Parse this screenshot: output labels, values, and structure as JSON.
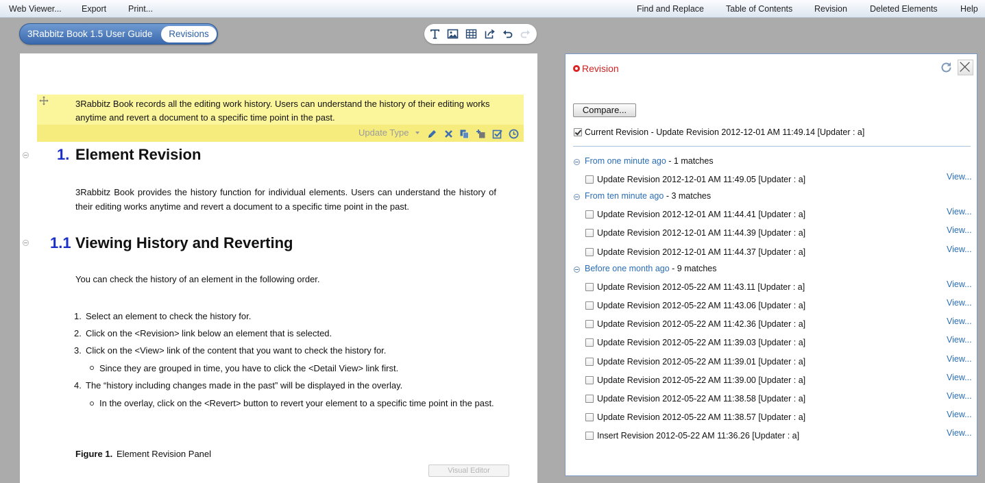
{
  "menu": {
    "left": [
      "Web Viewer...",
      "Export",
      "Print..."
    ],
    "right": [
      "Find and Replace",
      "Table of Contents",
      "Revision",
      "Deleted Elements",
      "Help"
    ]
  },
  "header": {
    "book_title": "3Rabbitz Book 1.5 User Guide",
    "revisions_button": "Revisions"
  },
  "toolbar": {
    "icons": [
      "text-icon",
      "image-icon",
      "table-icon",
      "export-icon",
      "undo-icon",
      "redo-icon"
    ]
  },
  "document": {
    "highlight_text": "3Rabbitz Book records all the editing work history. Users can understand the history of their editing works anytime and revert a document to a specific time point in the past.",
    "update_type_label": "Update Type",
    "element_icons": [
      "edit-icon",
      "delete-icon",
      "copy-icon",
      "insert-icon",
      "check-icon",
      "history-icon"
    ],
    "h1_number": "1.",
    "h1_title": "Element Revision",
    "para1": "3Rabbitz Book provides the history function for individual elements. Users can understand the history of their editing works anytime and revert a document to a specific time point in the past.",
    "h2_number": "1.1",
    "h2_title": "Viewing History and Reverting",
    "para2": "You can check the history of an element in the following order.",
    "steps": [
      {
        "num": "1.",
        "text": "Select an element to check the history for."
      },
      {
        "num": "2.",
        "text": "Click on the <Revision> link below an element that is selected."
      },
      {
        "num": "3.",
        "text": "Click on the <View> link of the content that you want to check the history for."
      },
      {
        "num": "4.",
        "text": "The “history including changes made in the past” will be displayed in the overlay."
      }
    ],
    "sub_steps": [
      "Since they are grouped in time, you have to click the <Detail View> link first.",
      "In the overlay, click on the <Revert> button to revert your element to a specific time point in the past."
    ],
    "figure_label": "Figure 1.",
    "figure_caption": "Element Revision Panel",
    "visual_editor_label": "Visual Editor"
  },
  "revision_panel": {
    "title": "Revision",
    "compare_button": "Compare...",
    "current_revision": "Current Revision - Update Revision 2012-12-01 AM 11:49.14 [Updater : a]",
    "view_label": "View...",
    "groups": [
      {
        "label": "From one minute ago",
        "suffix": " - 1 matches",
        "items": [
          "Update Revision 2012-12-01 AM 11:49.05 [Updater : a]"
        ]
      },
      {
        "label": "From ten minute ago",
        "suffix": " - 3 matches",
        "items": [
          "Update Revision 2012-12-01 AM 11:44.41 [Updater : a]",
          "Update Revision 2012-12-01 AM 11:44.39 [Updater : a]",
          "Update Revision 2012-12-01 AM 11:44.37 [Updater : a]"
        ]
      },
      {
        "label": "Before one month ago",
        "suffix": " - 9 matches",
        "items": [
          "Update Revision 2012-05-22 AM 11:43.11 [Updater : a]",
          "Update Revision 2012-05-22 AM 11:43.06 [Updater : a]",
          "Update Revision 2012-05-22 AM 11:42.36 [Updater : a]",
          "Update Revision 2012-05-22 AM 11:39.03 [Updater : a]",
          "Update Revision 2012-05-22 AM 11:39.01 [Updater : a]",
          "Update Revision 2012-05-22 AM 11:39.00 [Updater : a]",
          "Update Revision 2012-05-22 AM 11:38.58 [Updater : a]",
          "Update Revision 2012-05-22 AM 11:38.57 [Updater : a]",
          "Insert Revision 2012-05-22 AM 11:36.26 [Updater : a]"
        ]
      }
    ]
  }
}
